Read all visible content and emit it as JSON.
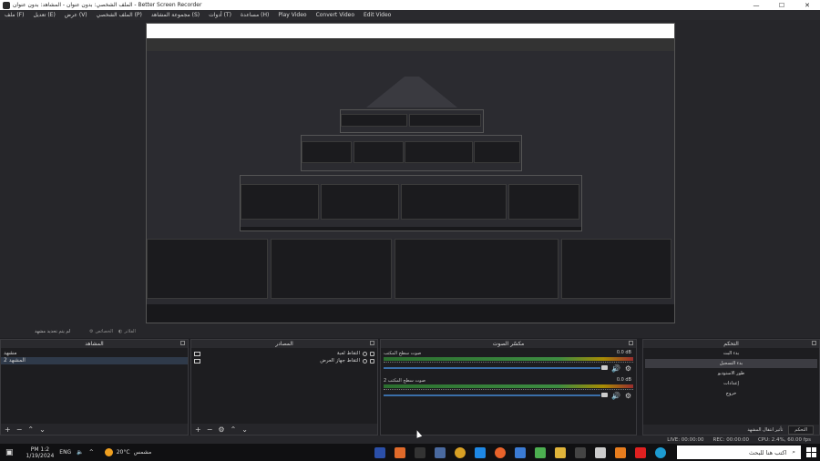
{
  "window": {
    "app": "Better Screen Recorder",
    "title": "الملف الشخصي: بدون عنوان - المشاهد: بدون عنوان - Better Screen Recorder",
    "controls": [
      "—",
      "☐",
      "✕"
    ]
  },
  "menu": [
    "ملف (F)",
    "تعديل (E)",
    "عرض (V)",
    "الملف الشخصي (P)",
    "مجموعة المشاهد (S)",
    "أدوات (T)",
    "مساعدة (H)",
    "Play Video",
    "Convert Video",
    "Edit Video"
  ],
  "toolbar": {
    "no_scene_selected": "لم يتم تحديد مشهد",
    "properties": "الخصائص",
    "filters": "الفلاتر"
  },
  "docks": {
    "scenes": {
      "title": "المشاهد",
      "items": [
        "مشهد",
        "المشهد 2"
      ],
      "selected_index": 1
    },
    "sources": {
      "title": "المصادر",
      "items": [
        "التقاط لعبة",
        "التقاط جهاز العرض"
      ]
    },
    "mixer": {
      "title": "مكسّر الصوت",
      "channels": [
        {
          "name": "صوت سطح المكتب",
          "db": "0.0 dB"
        },
        {
          "name": "صوت سطح المكتب 2",
          "db": "0.0 dB"
        }
      ]
    },
    "controls": {
      "title": "التحكم",
      "buttons": [
        "بدء البث",
        "بدء التسجيل",
        "طور الاستوديو",
        "إعدادات",
        "خروج"
      ],
      "active_index": 1,
      "tabs": [
        "التحكم",
        "تأثير انتقال المشهد"
      ]
    }
  },
  "status": {
    "live": "LIVE: 00:00:00",
    "rec": "REC: 00:00:00",
    "cpu": "CPU: 2.4%, 60.00 fps"
  },
  "taskbar": {
    "time": "PM 1:2",
    "date": "1/19/2024",
    "lang": "ENG",
    "weather_temp": "20°C",
    "weather_text": "مشمس",
    "search_placeholder": "اكتب هنا للبحث"
  },
  "colors": {
    "accent": "#3a6ea8",
    "background": "#1f1f23",
    "meter_green": "#43a047"
  }
}
